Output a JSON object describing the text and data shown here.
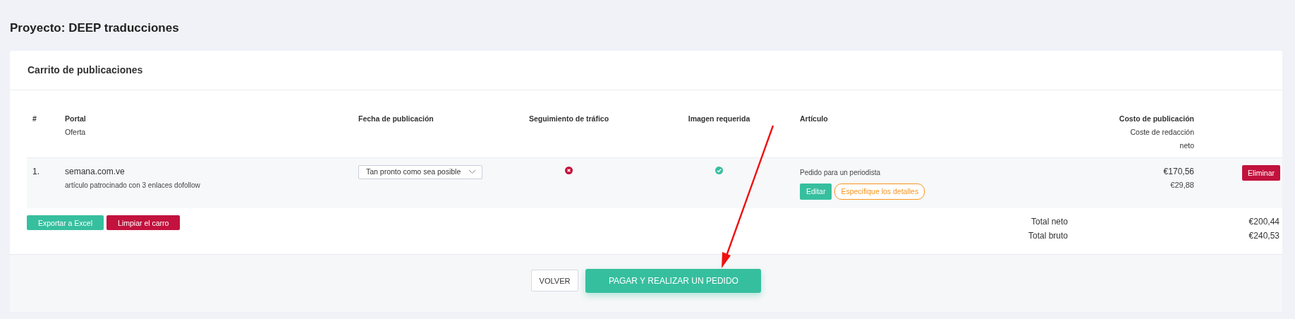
{
  "page": {
    "title": "Proyecto: DEEP traducciones"
  },
  "cart": {
    "title": "Carrito de publicaciones",
    "columns": [
      {
        "lines": [
          "#"
        ]
      },
      {
        "lines": [
          "Portal",
          "Oferta"
        ]
      },
      {
        "lines": [
          "Fecha de publicación"
        ]
      },
      {
        "lines": [
          "Seguimiento de tráfico"
        ]
      },
      {
        "lines": [
          "Imagen requerida"
        ]
      },
      {
        "lines": [
          "Artículo"
        ]
      },
      {
        "lines": [
          "Costo de publicación",
          "Coste de redacción",
          "neto"
        ]
      }
    ],
    "rows": [
      {
        "number": "1.",
        "portal": "semana.com.ve",
        "offer": "artículo patrocinado con 3 enlaces dofollow",
        "date": "Tan pronto como sea posible",
        "traffic_tracking": false,
        "image_required": true,
        "article": "Pedido para un periodista",
        "edit": "Editar",
        "details": "Especifique los detalles",
        "cost": "€170,56",
        "writing_cost": "€29,88",
        "delete": "Eliminar"
      }
    ],
    "actions": [
      {
        "label": "Exportar a Excel",
        "kind": "success"
      },
      {
        "label": "Limpiar el carro",
        "kind": "danger"
      }
    ],
    "totals": [
      {
        "label": "Total neto",
        "value": "€200,44"
      },
      {
        "label": "Total bruto",
        "value": "€240,53"
      }
    ]
  },
  "footer": {
    "buttons": [
      {
        "label": "VOLVER",
        "kind": "secondary"
      },
      {
        "label": "PAGAR Y REALIZAR UN PEDIDO",
        "kind": "primary"
      }
    ]
  }
}
